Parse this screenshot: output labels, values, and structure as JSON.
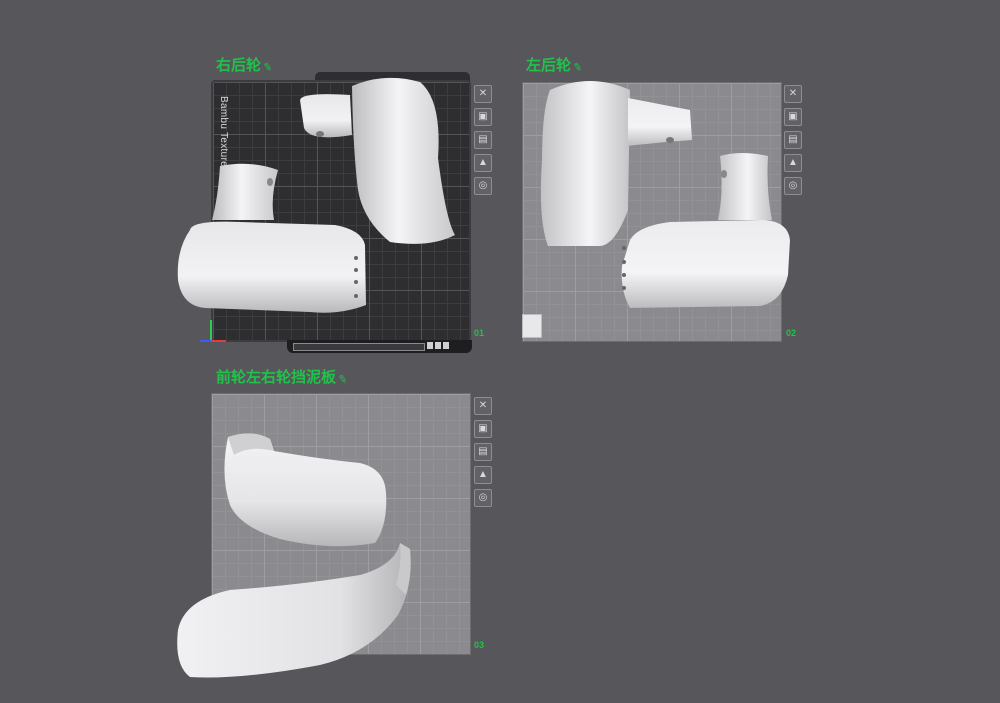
{
  "plates": [
    {
      "title": "右后轮",
      "number": "01",
      "side_label": "Bambu Texture"
    },
    {
      "title": "左后轮",
      "number": "02"
    },
    {
      "title": "前轮左右轮挡泥板",
      "number": "03"
    }
  ],
  "icons": {
    "edit": "pencil-icon",
    "toolbar": [
      "close-icon",
      "arrange-icon",
      "orient-icon",
      "lock-icon",
      "settings-icon"
    ]
  },
  "colors": {
    "background": "#57565b",
    "title": "#1fc34a",
    "plate_grid": "#8b8b8f",
    "textured_plate": "#2e2e31"
  }
}
